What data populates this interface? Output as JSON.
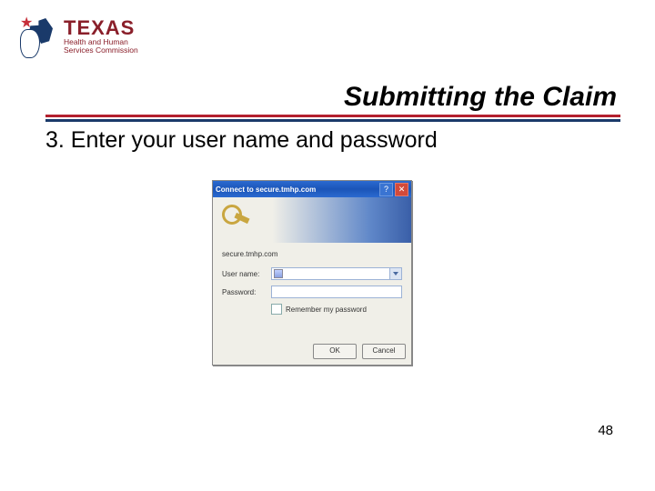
{
  "logo": {
    "brand": "TEXAS",
    "line1": "Health and Human",
    "line2": "Services Commission"
  },
  "title": "Submitting the Claim",
  "body": "3. Enter your user name and password",
  "page_number": "48",
  "dialog": {
    "window_title": "Connect to secure.tmhp.com",
    "host": "secure.tmhp.com",
    "username_label": "User name:",
    "password_label": "Password:",
    "remember_label": "Remember my password",
    "ok_label": "OK",
    "cancel_label": "Cancel",
    "help_glyph": "?",
    "close_glyph": "✕"
  }
}
